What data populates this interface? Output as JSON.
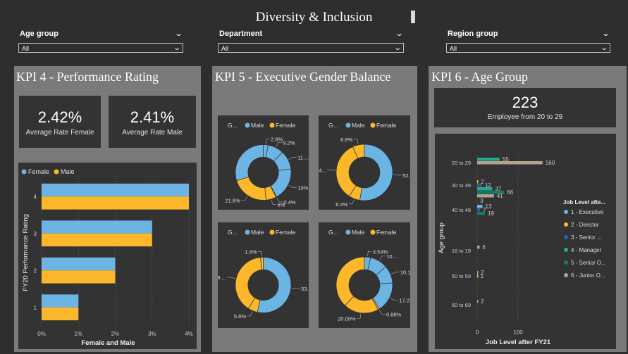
{
  "page": {
    "title": "Diversity & Inclusion"
  },
  "filters": [
    {
      "label": "Age group",
      "value": "All"
    },
    {
      "label": "Department",
      "value": "All"
    },
    {
      "label": "Region group",
      "value": "All"
    }
  ],
  "kpi4": {
    "title": "KPI 4 - Performance Rating",
    "cards": [
      {
        "value": "2.42%",
        "label": "Average Rate Female"
      },
      {
        "value": "2.41%",
        "label": "Average Rate Male"
      }
    ]
  },
  "kpi5": {
    "title": "KPI 5 - Executive Gender Balance"
  },
  "kpi6": {
    "title": "KPI 6 - Age Group",
    "card": {
      "value": "223",
      "label": "Employee from 20 to 29"
    }
  },
  "colors": {
    "female": "#6cb4e4",
    "male": "#fcb82a",
    "executive": "#6cb4e4",
    "director": "#fcb82a",
    "senior_a": "#2a5fa6",
    "manager": "#23a98c",
    "senior_o": "#157a6a",
    "junior": "#b3a38e"
  },
  "chart_data": [
    {
      "type": "bar",
      "orientation": "horizontal",
      "legend": [
        "Female",
        "Male"
      ],
      "categories": [
        "4",
        "3",
        "2",
        "1"
      ],
      "series": [
        {
          "name": "Female",
          "values": [
            4.0,
            3.0,
            2.0,
            1.0
          ]
        },
        {
          "name": "Male",
          "values": [
            4.0,
            3.0,
            2.0,
            1.0
          ]
        }
      ],
      "x_ticks": [
        "0%",
        "1%",
        "2%",
        "3%",
        "4%"
      ],
      "xlim": [
        0,
        4
      ],
      "xlabel": "Female and Male",
      "ylabel": "FY20 Performance Rating"
    },
    {
      "type": "pie",
      "title": "G...",
      "legend": [
        "Male",
        "Female"
      ],
      "slices": [
        {
          "series": "Male",
          "value": 2.8,
          "label": "2.8%"
        },
        {
          "series": "Male",
          "value": 9.2,
          "label": "9.2%"
        },
        {
          "series": "Male",
          "value": 11.0,
          "label": "11...."
        },
        {
          "series": "Male",
          "value": 19.0,
          "label": "19%"
        },
        {
          "series": "Male",
          "value": 0.4,
          "label": "0.4%"
        },
        {
          "series": "Female",
          "value": 6.0,
          "label": "6%"
        },
        {
          "series": "Female",
          "value": 21.8,
          "label": "21.8%"
        },
        {
          "series": "Male",
          "value": 29.8,
          "label": ""
        }
      ]
    },
    {
      "type": "pie",
      "title": "G...",
      "legend": [
        "Male",
        "Female"
      ],
      "slices": [
        {
          "series": "Male",
          "value": 52.6,
          "label": "52.6%"
        },
        {
          "series": "Female",
          "value": 6.4,
          "label": "6.4%"
        },
        {
          "series": "Female",
          "value": 34.2,
          "label": "34..."
        },
        {
          "series": "Female",
          "value": 6.8,
          "label": "6.8%"
        }
      ]
    },
    {
      "type": "pie",
      "title": "G...",
      "legend": [
        "Male",
        "Female"
      ],
      "slices": [
        {
          "series": "Male",
          "value": 53.4,
          "label": "53.4%"
        },
        {
          "series": "Female",
          "value": 5.6,
          "label": "5.6%"
        },
        {
          "series": "Female",
          "value": 39.4,
          "label": "39...."
        },
        {
          "series": "Female",
          "value": 1.6,
          "label": "1.6%"
        }
      ]
    },
    {
      "type": "pie",
      "title": "G...",
      "legend": [
        "Male",
        "Female"
      ],
      "slices": [
        {
          "series": "Male",
          "value": 3.53,
          "label": "3.53%"
        },
        {
          "series": "Male",
          "value": 10.2,
          "label": "10...."
        },
        {
          "series": "Male",
          "value": 10.1,
          "label": "10.1..."
        },
        {
          "series": "Male",
          "value": 17.22,
          "label": "17.22%"
        },
        {
          "series": "Female",
          "value": 0.88,
          "label": "0.88%"
        },
        {
          "series": "Female",
          "value": 20.09,
          "label": "20.09%"
        },
        {
          "series": "Female",
          "value": 37.98,
          "label": ""
        }
      ]
    },
    {
      "type": "bar",
      "orientation": "horizontal",
      "categories": [
        "20 to 29",
        "30 to 39",
        "40 to 49",
        "16 to 19",
        "50 to 59",
        "60 to 69"
      ],
      "ylabel": "Age group",
      "xlabel": "Job Level after FY21",
      "x_ticks": [
        "0",
        "100"
      ],
      "xlim": [
        0,
        200
      ],
      "legend_title": "Job Level afte...",
      "series": [
        {
          "name": "1 - Executive",
          "values": [
            null,
            null,
            13,
            null,
            2,
            2
          ]
        },
        {
          "name": "2 - Director",
          "values": [
            null,
            2,
            null,
            null,
            1,
            null
          ]
        },
        {
          "name": "3 - Senior ...",
          "values": [
            null,
            12,
            7,
            null,
            null,
            null
          ]
        },
        {
          "name": "4 - Manager",
          "values": [
            55,
            37,
            null,
            null,
            null,
            null
          ]
        },
        {
          "name": "5 - Senior O...",
          "values": [
            null,
            66,
            19,
            null,
            null,
            null
          ]
        },
        {
          "name": "6 - Junior O...",
          "values": [
            160,
            41,
            null,
            6,
            null,
            null
          ]
        }
      ],
      "extra_labels": [
        {
          "category": "30 to 39",
          "label": "3"
        }
      ]
    }
  ]
}
